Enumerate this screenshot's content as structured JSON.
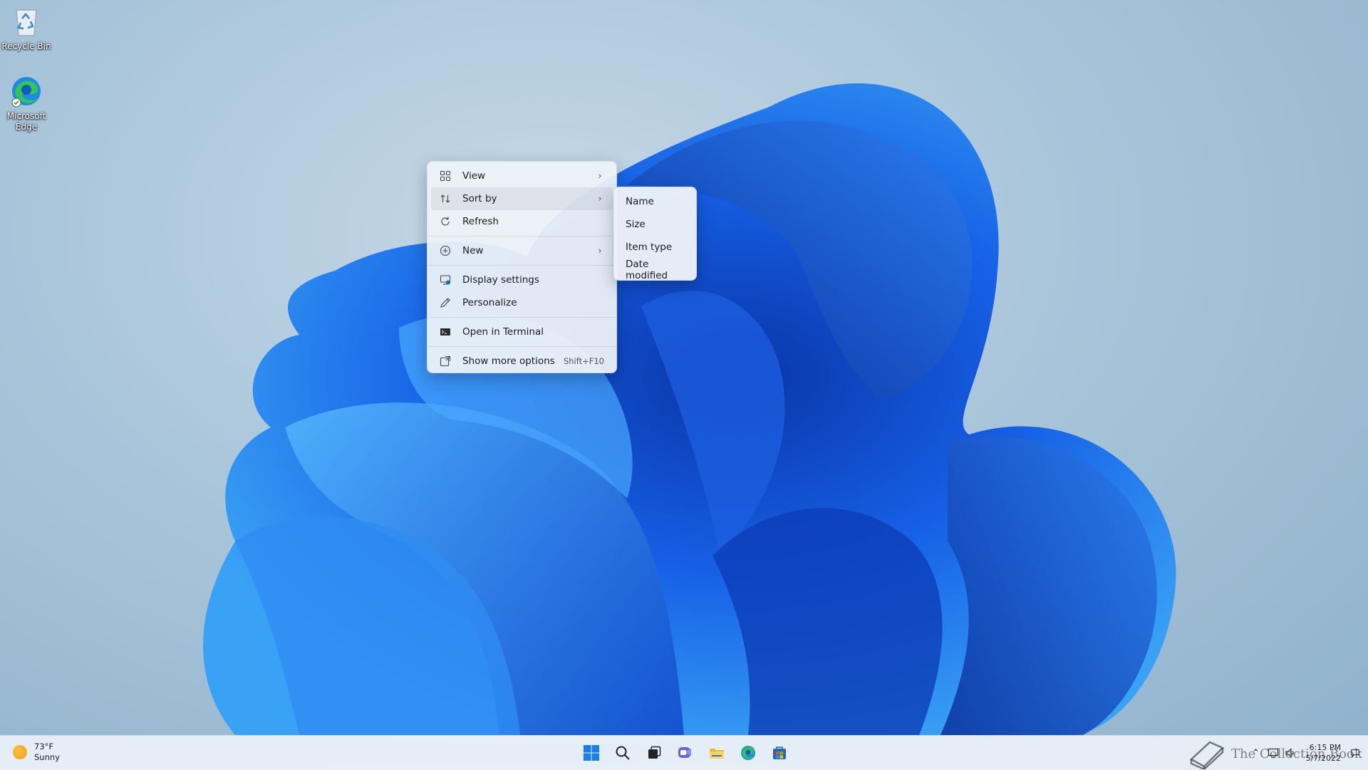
{
  "desktop": {
    "icons": [
      {
        "label": "Recycle Bin"
      },
      {
        "label": "Microsoft Edge"
      }
    ]
  },
  "context_menu": {
    "items": [
      {
        "label": "View",
        "icon": "grid-view-icon",
        "has_submenu": true
      },
      {
        "label": "Sort by",
        "icon": "sort-icon",
        "has_submenu": true,
        "highlighted": true
      },
      {
        "label": "Refresh",
        "icon": "refresh-icon"
      },
      {
        "label": "New",
        "icon": "plus-circle-icon",
        "has_submenu": true
      },
      {
        "label": "Display settings",
        "icon": "display-settings-icon"
      },
      {
        "label": "Personalize",
        "icon": "pen-icon"
      },
      {
        "label": "Open in Terminal",
        "icon": "terminal-icon"
      },
      {
        "label": "Show more options",
        "icon": "more-options-icon",
        "shortcut": "Shift+F10"
      }
    ]
  },
  "sort_submenu": {
    "items": [
      {
        "label": "Name"
      },
      {
        "label": "Size"
      },
      {
        "label": "Item type"
      },
      {
        "label": "Date modified"
      }
    ]
  },
  "taskbar": {
    "weather": {
      "temp": "73°F",
      "condition": "Sunny"
    },
    "apps": [
      "start-icon",
      "search-icon",
      "task-view-icon",
      "chat-icon",
      "file-explorer-icon",
      "edge-icon",
      "store-icon"
    ],
    "clock": {
      "time": "6:15 PM",
      "date": "5/7/2022"
    }
  },
  "watermark": {
    "text": "The Collection Book"
  },
  "colors": {
    "accent": "#0f6cbd",
    "wallpaper_blue": "#1a5fe0"
  }
}
